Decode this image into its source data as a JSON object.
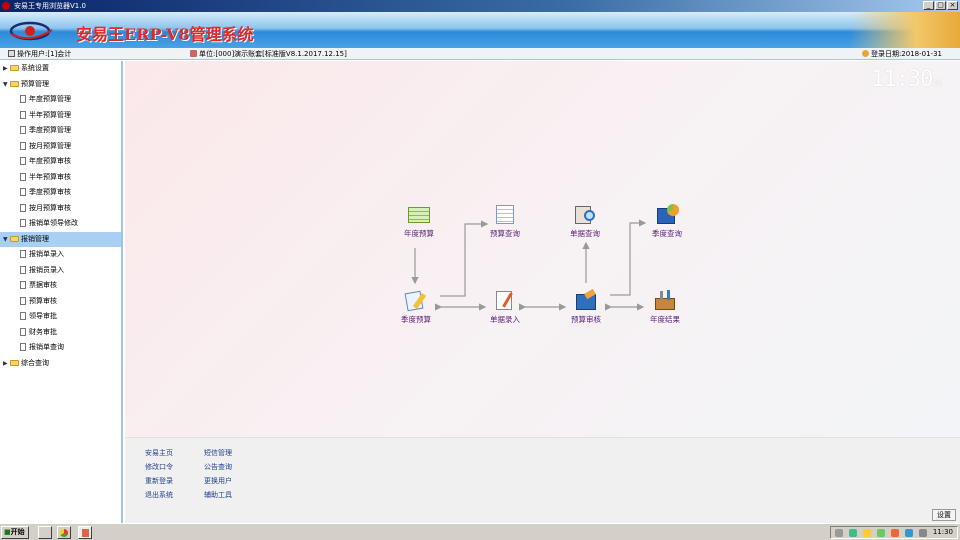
{
  "window": {
    "title": "安易王专用浏览器V1.0",
    "buttons": [
      "_",
      "▢",
      "×"
    ]
  },
  "banner": {
    "title": "安易王ERP-V8管理系统"
  },
  "infobar": {
    "operator": "操作用户:[1]会计",
    "unit": "单位:[000]演示账套[标准版V8.1.2017.12.15]",
    "login_date": "登录日期:2018-01-31"
  },
  "clock": {
    "hm": "11:30",
    "sec": "38"
  },
  "sidebar": {
    "groups": [
      {
        "label": "系统设置",
        "expanded": false,
        "items": []
      },
      {
        "label": "预算管理",
        "expanded": true,
        "items": [
          "年度预算管理",
          "半年预算管理",
          "季度预算管理",
          "按月预算管理",
          "年度预算审核",
          "半年预算审核",
          "季度预算审核",
          "按月预算审核",
          "报销单领导修改"
        ]
      },
      {
        "label": "报销管理",
        "expanded": true,
        "selected": true,
        "items": [
          "报销单录入",
          "报销员录入",
          "票据审核",
          "预算审核",
          "领导审批",
          "财务审批",
          "报销单查询"
        ]
      },
      {
        "label": "综合查询",
        "expanded": false,
        "items": []
      }
    ]
  },
  "flow": {
    "annual_budget": "年度预算",
    "budget_query": "预算查询",
    "doc_query": "单据查询",
    "quarter_query": "季度查询",
    "quarter_budget": "季度预算",
    "doc_entry": "单据录入",
    "budget_review": "预算审核",
    "annual_settle": "年度结果"
  },
  "footer": {
    "links": [
      "安易主页",
      "短信管理",
      "修改口令",
      "公告查询",
      "重新登录",
      "更换用户",
      "退出系统",
      "辅助工具"
    ],
    "settings": "设置"
  },
  "taskbar": {
    "start": "开始",
    "time": "11:30"
  }
}
